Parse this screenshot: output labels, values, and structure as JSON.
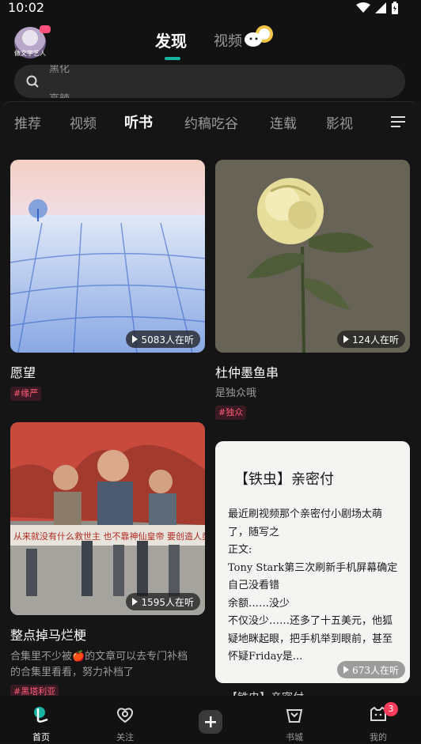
{
  "status_bar": {
    "time": "10:02"
  },
  "header": {
    "avatar_caption": "做文字艺人",
    "tab_discover": "发现",
    "tab_video": "视频"
  },
  "search": {
    "hint_line_1": "黑化",
    "hint_line_2": "高辣"
  },
  "categories": [
    {
      "label": "推荐"
    },
    {
      "label": "视频"
    },
    {
      "label": "听书"
    },
    {
      "label": "约稿吃谷"
    },
    {
      "label": "连载"
    },
    {
      "label": "影视"
    }
  ],
  "cards": [
    {
      "title": "愿望",
      "subtitle": "",
      "tag": "#缘严",
      "listeners": "5083人在听"
    },
    {
      "title": "杜仲墨鱼串",
      "subtitle": "是独众哦",
      "tag": "#独众",
      "listeners": "124人在听"
    },
    {
      "title": "整点掉马烂梗",
      "subtitle_line_1": "合集里不少被🍎的文章可以去专门补档",
      "subtitle_line_2": "的合集里看看，努力补档了",
      "tag": "#黑塔利亚",
      "listeners": "1595人在听"
    },
    {
      "title": "【铁虫】亲密付",
      "body": "最近刷视频那个亲密付小剧场太萌了，随写之\n正文:\nTony Stark第三次刷新手机屏幕确定自己没看错\n余额……没少\n不仅没少……还多了十五美元，他狐疑地眯起眼，把手机举到眼前，甚至怀疑Friday是...",
      "listeners": "673人在听",
      "below_title": "【铁虫】亲密付"
    }
  ],
  "bottom_nav": [
    {
      "label": "首页"
    },
    {
      "label": "关注"
    },
    {
      "label": "书城"
    },
    {
      "label": "我的"
    }
  ],
  "notification_count": "3",
  "colors": {
    "accent": "#15b3a0",
    "tag": "#ff5a79",
    "badge": "#ff3b5c"
  }
}
